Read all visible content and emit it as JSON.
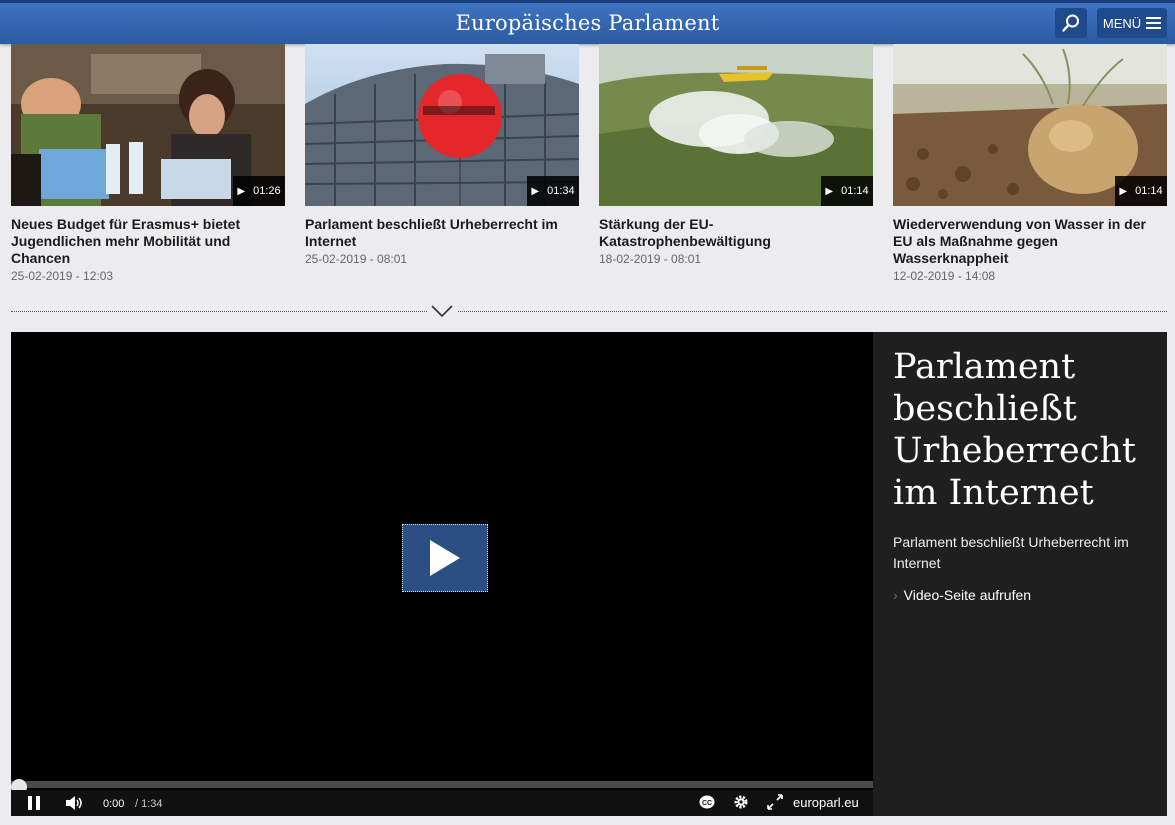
{
  "header": {
    "title": "Europäisches Parlament",
    "menu_label": "MENÜ"
  },
  "videos": [
    {
      "title": "Neues Budget für Erasmus+ bietet Jugendlichen mehr Mobilität und Chancen",
      "date": "25-02-2019 - 12:03",
      "duration": "01:26"
    },
    {
      "title": "Parlament beschließt Urheberrecht im Internet",
      "date": "25-02-2019 - 08:01",
      "duration": "01:34"
    },
    {
      "title": "Stärkung der EU-Katastrophenbewältigung",
      "date": "18-02-2019 - 08:01",
      "duration": "01:14"
    },
    {
      "title": "Wiederverwendung von Wasser in der EU als Maßnahme gegen Wasserknappheit",
      "date": "12-02-2019 - 14:08",
      "duration": "01:14"
    }
  ],
  "player": {
    "current_time": "0:00",
    "total_time": "/ 1:34",
    "brand": "europarl.eu",
    "progress": 0
  },
  "feature": {
    "title": "Parlament beschließt Urheberrecht im Internet",
    "description": "Parlament beschließt Urheberrecht im Internet",
    "link_label": "Video-Seite aufrufen"
  },
  "colors": {
    "header_blue": "#2b5aa0",
    "panel_dark": "#1f1f1f",
    "play_button": "#2b4f82"
  }
}
